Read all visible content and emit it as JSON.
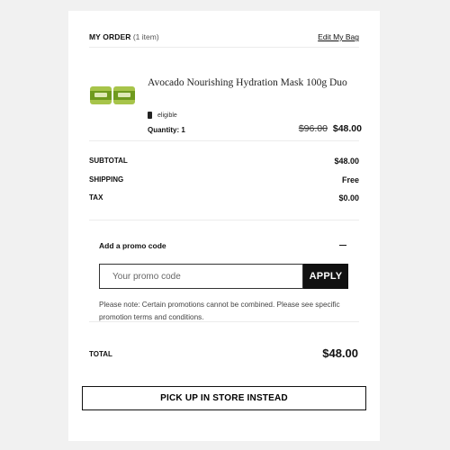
{
  "order": {
    "title": "MY ORDER",
    "count": "(1 item)",
    "edit_label": "Edit My Bag"
  },
  "product": {
    "name": "Avocado Nourishing Hydration Mask 100g Duo",
    "eligibility": "eligible",
    "quantity_label": "Quantity: 1",
    "old_price": "$96.00",
    "new_price": "$48.00"
  },
  "summary": {
    "subtotal_label": "SUBTOTAL",
    "subtotal_value": "$48.00",
    "shipping_label": "SHIPPING",
    "shipping_value": "Free",
    "tax_label": "TAX",
    "tax_value": "$0.00"
  },
  "promo": {
    "title": "Add a promo code",
    "placeholder": "Your promo code",
    "apply_label": "APPLY",
    "note": "Please note: Certain promotions cannot be combined. Please see specific promotion terms and conditions."
  },
  "total": {
    "label": "TOTAL",
    "value": "$48.00"
  },
  "pickup_label": "PICK UP IN STORE INSTEAD"
}
